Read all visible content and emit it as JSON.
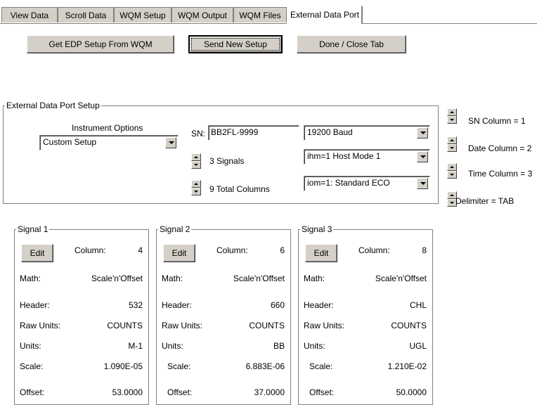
{
  "tabs": [
    {
      "label": "View Data"
    },
    {
      "label": "Scroll Data"
    },
    {
      "label": "WQM Setup"
    },
    {
      "label": "WQM Output"
    },
    {
      "label": "WQM Files"
    },
    {
      "label": "External Data Port"
    }
  ],
  "toolbar": {
    "get_label": "Get EDP Setup From WQM",
    "send_label": "Send New Setup",
    "done_label": "Done / Close Tab"
  },
  "edp": {
    "group_label": "External Data Port Setup",
    "instrument_options_label": "Instrument Options",
    "instrument_options_value": "Custom Setup",
    "sn_label": "SN:",
    "sn_value": "BB2FL-9999",
    "signals_text": "3 Signals",
    "total_columns_text": "9 Total Columns",
    "baud_value": "19200 Baud",
    "host_mode_value": "ihm=1  Host Mode 1",
    "output_mode_value": "iom=1:  Standard ECO"
  },
  "side": {
    "sn_column": "SN Column = 1",
    "date_column": "Date Column = 2",
    "time_column": "Time Column = 3",
    "delimiter": "Delimiter = TAB"
  },
  "signals": [
    {
      "title": "Signal 1",
      "edit_label": "Edit",
      "column_label": "Column:",
      "column": "4",
      "math_label": "Math:",
      "math": "Scale'n'Offset",
      "header_label": "Header:",
      "header": "532",
      "raw_units_label": "Raw Units:",
      "raw_units": "COUNTS",
      "units_label": "Units:",
      "units": "M-1",
      "scale_label": "Scale:",
      "scale": "1.090E-05",
      "offset_label": "Offset:",
      "offset": "53.0000"
    },
    {
      "title": "Signal 2",
      "edit_label": "Edit",
      "column_label": "Column:",
      "column": "6",
      "math_label": "Math:",
      "math": "Scale'n'Offset",
      "header_label": "Header:",
      "header": "660",
      "raw_units_label": "Raw Units:",
      "raw_units": "COUNTS",
      "units_label": "Units:",
      "units": "BB",
      "scale_label": "Scale:",
      "scale": "6.883E-06",
      "offset_label": "Offset:",
      "offset": "37.0000"
    },
    {
      "title": "Signal 3",
      "edit_label": "Edit",
      "column_label": "Column:",
      "column": "8",
      "math_label": "Math:",
      "math": "Scale'n'Offset",
      "header_label": "Header:",
      "header": "CHL",
      "raw_units_label": "Raw Units:",
      "raw_units": "COUNTS",
      "units_label": "Units:",
      "units": "UGL",
      "scale_label": "Scale:",
      "scale": "1.210E-02",
      "offset_label": "Offset:",
      "offset": "50.0000"
    }
  ]
}
